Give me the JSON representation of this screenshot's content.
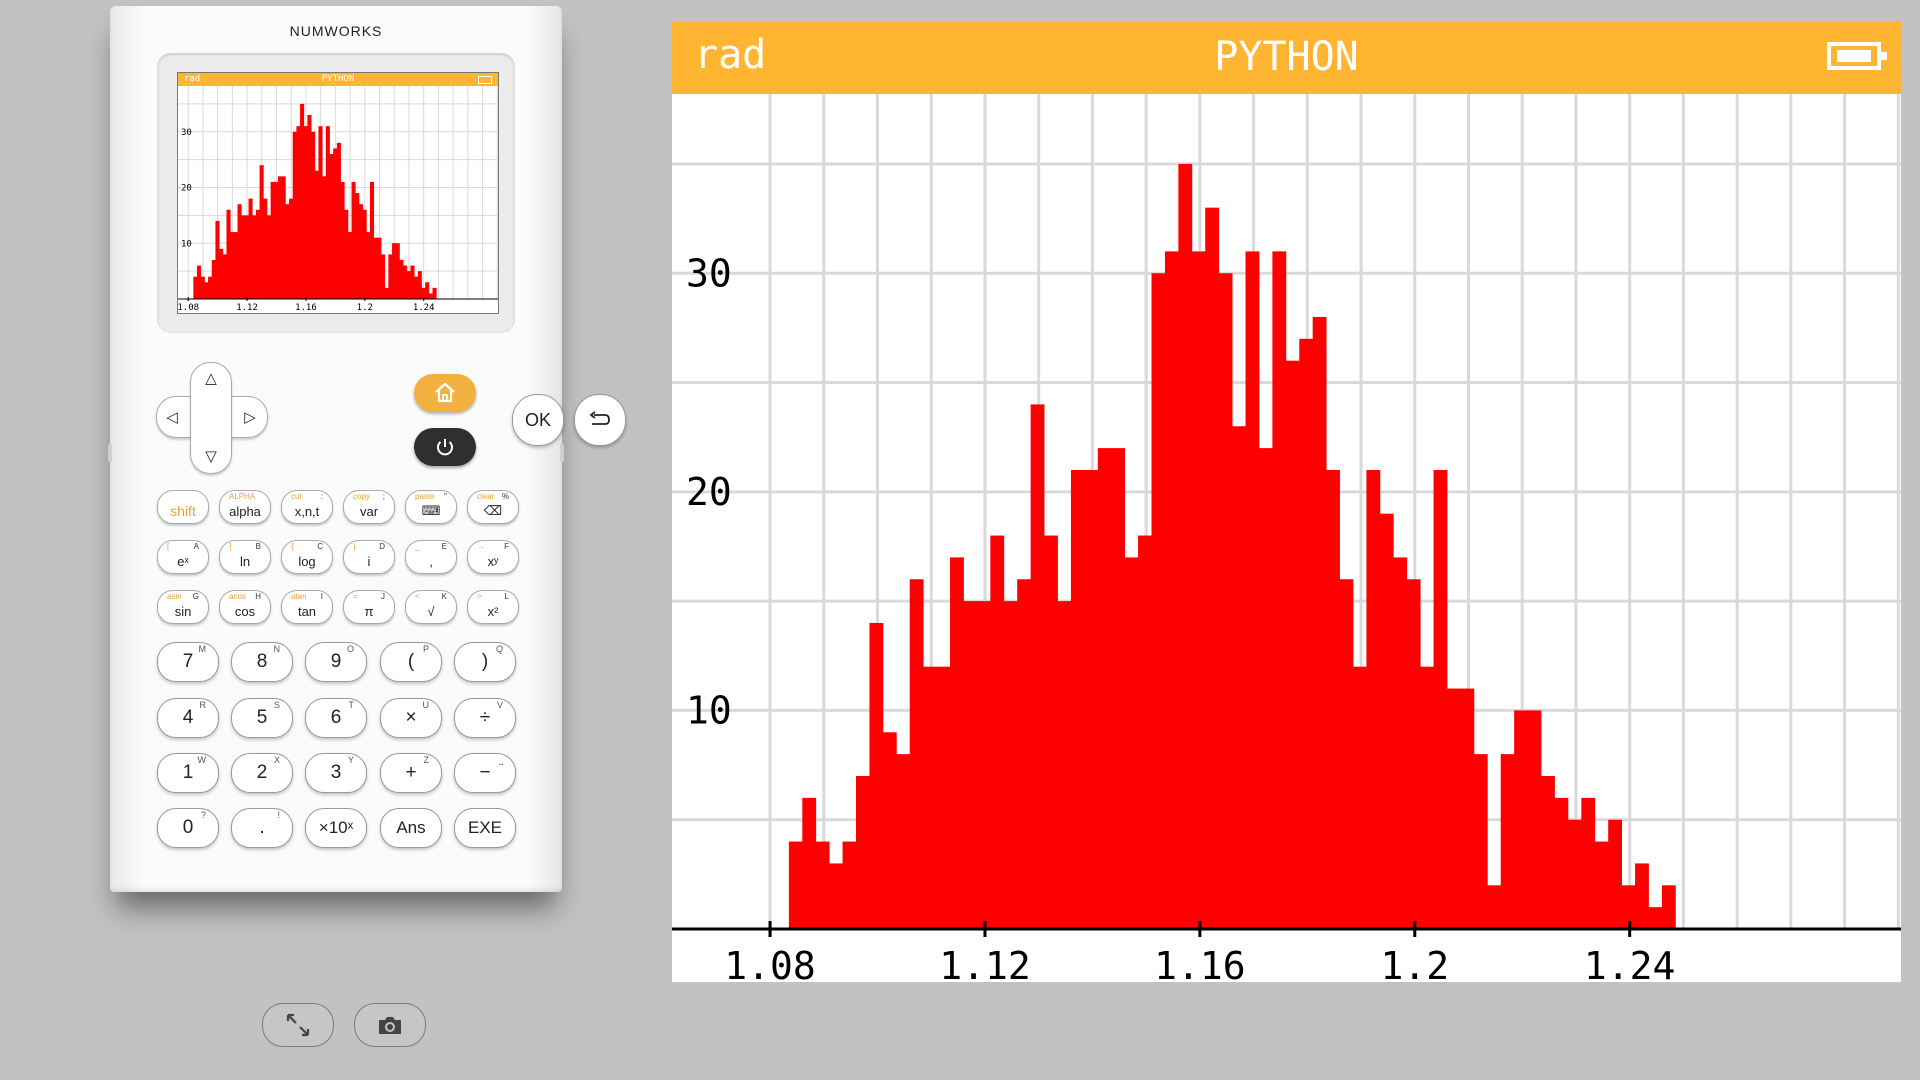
{
  "calculator": {
    "brand": "NUMWORKS",
    "status_bar": {
      "angle_mode": "rad",
      "app_title": "PYTHON",
      "battery_icon": "battery-icon"
    },
    "dpad": {
      "up": "△",
      "down": "▽",
      "left": "◁",
      "right": "▷"
    },
    "home_icon": "home-icon",
    "power_icon": "power-icon",
    "ok_label": "OK",
    "back_icon": "back-arrow-icon",
    "function_keys": [
      {
        "main": "shift",
        "sup1": "",
        "sup2": ""
      },
      {
        "main": "alpha",
        "sup1": "ALPHA",
        "sup2": ""
      },
      {
        "main": "x,n,t",
        "sup1": "cut",
        "sup2": ":"
      },
      {
        "main": "var",
        "sup1": "copy",
        "sup2": ";"
      },
      {
        "main": "⌨",
        "sup1": "paste",
        "sup2": "\""
      },
      {
        "main": "⌫",
        "sup1": "clear",
        "sup2": "%"
      },
      {
        "main": "eˣ",
        "sup1": "[",
        "sup2": "A"
      },
      {
        "main": "ln",
        "sup1": "]",
        "sup2": "B"
      },
      {
        "main": "log",
        "sup1": "{",
        "sup2": "C"
      },
      {
        "main": "i",
        "sup1": "}",
        "sup2": "D"
      },
      {
        "main": ",",
        "sup1": "_",
        "sup2": "E"
      },
      {
        "main": "xʸ",
        "sup1": "→",
        "sup2": "F"
      },
      {
        "main": "sin",
        "sup1": "asin",
        "sup2": "G"
      },
      {
        "main": "cos",
        "sup1": "acos",
        "sup2": "H"
      },
      {
        "main": "tan",
        "sup1": "atan",
        "sup2": "I"
      },
      {
        "main": "π",
        "sup1": "=",
        "sup2": "J"
      },
      {
        "main": "√",
        "sup1": "<",
        "sup2": "K"
      },
      {
        "main": "x²",
        "sup1": ">",
        "sup2": "L"
      }
    ],
    "number_keys": [
      {
        "main": "7",
        "sup": "M"
      },
      {
        "main": "8",
        "sup": "N"
      },
      {
        "main": "9",
        "sup": "O"
      },
      {
        "main": "(",
        "sup": "P"
      },
      {
        "main": ")",
        "sup": "Q"
      },
      {
        "main": "4",
        "sup": "R"
      },
      {
        "main": "5",
        "sup": "S"
      },
      {
        "main": "6",
        "sup": "T"
      },
      {
        "main": "×",
        "sup": "U"
      },
      {
        "main": "÷",
        "sup": "V"
      },
      {
        "main": "1",
        "sup": "W"
      },
      {
        "main": "2",
        "sup": "X"
      },
      {
        "main": "3",
        "sup": "Y"
      },
      {
        "main": "+",
        "sup": "Z"
      },
      {
        "main": "−",
        "sup": "⎵"
      },
      {
        "main": "0",
        "sup": "?"
      },
      {
        "main": ".",
        "sup": "!"
      },
      {
        "main": "×10ˣ",
        "sup": ""
      },
      {
        "main": "Ans",
        "sup": ""
      },
      {
        "main": "EXE",
        "sup": ""
      }
    ]
  },
  "toolbar": {
    "fullscreen_icon": "fullscreen-icon",
    "screenshot_icon": "camera-icon"
  },
  "screen": {
    "angle_mode": "rad",
    "app_title": "PYTHON",
    "battery_icon": "battery-icon",
    "colors": {
      "title_bar": "#ffb531",
      "bars": "#ff0000",
      "grid": "#d9d9d9"
    }
  },
  "chart_data": {
    "type": "bar",
    "title": "",
    "xlabel": "",
    "ylabel": "",
    "x_ticks": [
      "1.08",
      "1.12",
      "1.16",
      "1.2",
      "1.24"
    ],
    "y_ticks": [
      "10",
      "20",
      "30"
    ],
    "xlim": [
      1.0785,
      1.2905
    ],
    "ylim": [
      0,
      38.2
    ],
    "bin_start": 1.0835,
    "bin_width": 0.0025,
    "values": [
      4,
      6,
      4,
      3,
      4,
      7,
      14,
      9,
      8,
      16,
      12,
      12,
      17,
      15,
      15,
      18,
      15,
      16,
      24,
      18,
      15,
      21,
      21,
      22,
      22,
      17,
      18,
      30,
      31,
      35,
      31,
      33,
      30,
      23,
      31,
      22,
      31,
      26,
      27,
      28,
      21,
      16,
      12,
      21,
      19,
      17,
      16,
      12,
      21,
      11,
      11,
      8,
      2,
      8,
      10,
      10,
      7,
      6,
      5,
      6,
      4,
      5,
      2,
      3,
      1,
      2
    ]
  }
}
